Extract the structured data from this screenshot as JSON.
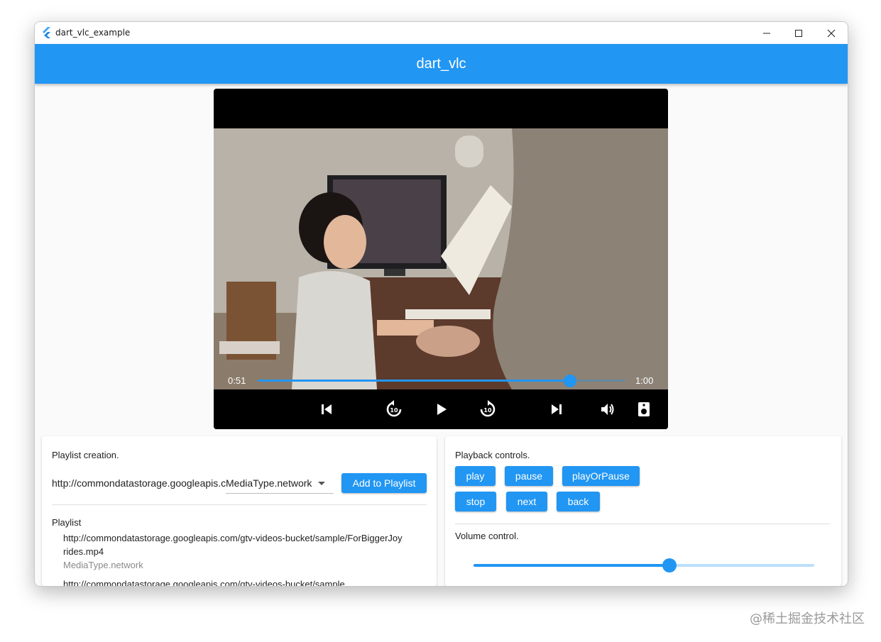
{
  "window": {
    "title": "dart_vlc_example"
  },
  "appbar": {
    "title": "dart_vlc"
  },
  "player": {
    "position": "0:51",
    "duration": "1:00",
    "progress_fraction": 0.85,
    "controls": [
      "skip-previous-icon",
      "replay-10-icon",
      "play-icon",
      "forward-10-icon",
      "skip-next-icon",
      "volume-icon",
      "speaker-icon"
    ]
  },
  "playlist_creation": {
    "title": "Playlist creation.",
    "url_value": "http://commondatastorage.googleapis.c",
    "media_type": "MediaType.network",
    "add_button": "Add to Playlist"
  },
  "playlist": {
    "title": "Playlist",
    "items": [
      {
        "url": "http://commondatastorage.googleapis.com/gtv-videos-bucket/sample/ForBiggerJoyrides.mp4",
        "type": "MediaType.network"
      },
      {
        "url": "http://commondatastorage.googleapis.com/gtv-videos-bucket/sample",
        "type": ""
      }
    ]
  },
  "playback_controls": {
    "title": "Playback controls.",
    "buttons": [
      "play",
      "pause",
      "playOrPause",
      "stop",
      "next",
      "back"
    ]
  },
  "volume_control": {
    "title": "Volume control.",
    "level_fraction": 0.575
  },
  "watermark": "@稀土掘金技术社区",
  "colors": {
    "accent": "#2196f3"
  }
}
